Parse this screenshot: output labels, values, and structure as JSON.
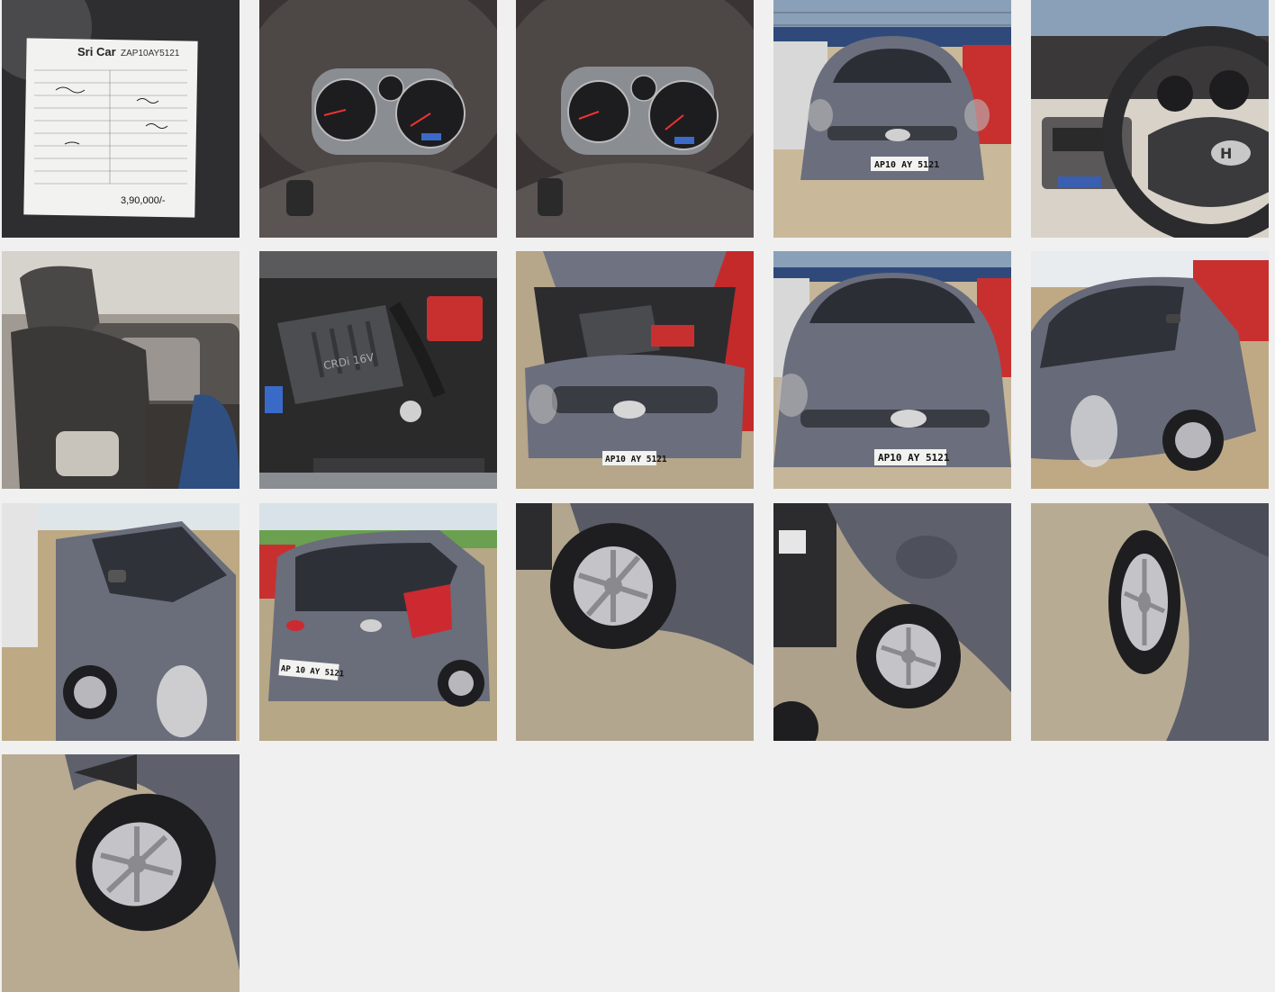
{
  "gallery": {
    "photos": [
      {
        "subject": "summary-sheet",
        "sheet_title": "Sri Car",
        "sheet_reg": "ZAP10AY5121",
        "sheet_price": "3,90,000/-"
      },
      {
        "subject": "instrument-cluster"
      },
      {
        "subject": "instrument-cluster"
      },
      {
        "subject": "front-view",
        "plate": "AP10 AY 5121"
      },
      {
        "subject": "dashboard-steering"
      },
      {
        "subject": "rear-seats"
      },
      {
        "subject": "engine-bay",
        "engine_badge": "CRDi 16V"
      },
      {
        "subject": "engine-bay-front",
        "plate": "AP10 AY 5121"
      },
      {
        "subject": "front-closeup",
        "plate": "AP10 AY 5121"
      },
      {
        "subject": "side-angle-front"
      },
      {
        "subject": "side-angle-rear"
      },
      {
        "subject": "rear-view",
        "plate": "AP 10 AY 5121"
      },
      {
        "subject": "wheel-closeup"
      },
      {
        "subject": "wheel-arch-dent"
      },
      {
        "subject": "wheel-closeup"
      },
      {
        "subject": "wheel-closeup"
      }
    ]
  },
  "colors": {
    "page_bg": "#f0f0f0",
    "car_body": "#6a6d7a",
    "gravel": "#b8a98e"
  }
}
